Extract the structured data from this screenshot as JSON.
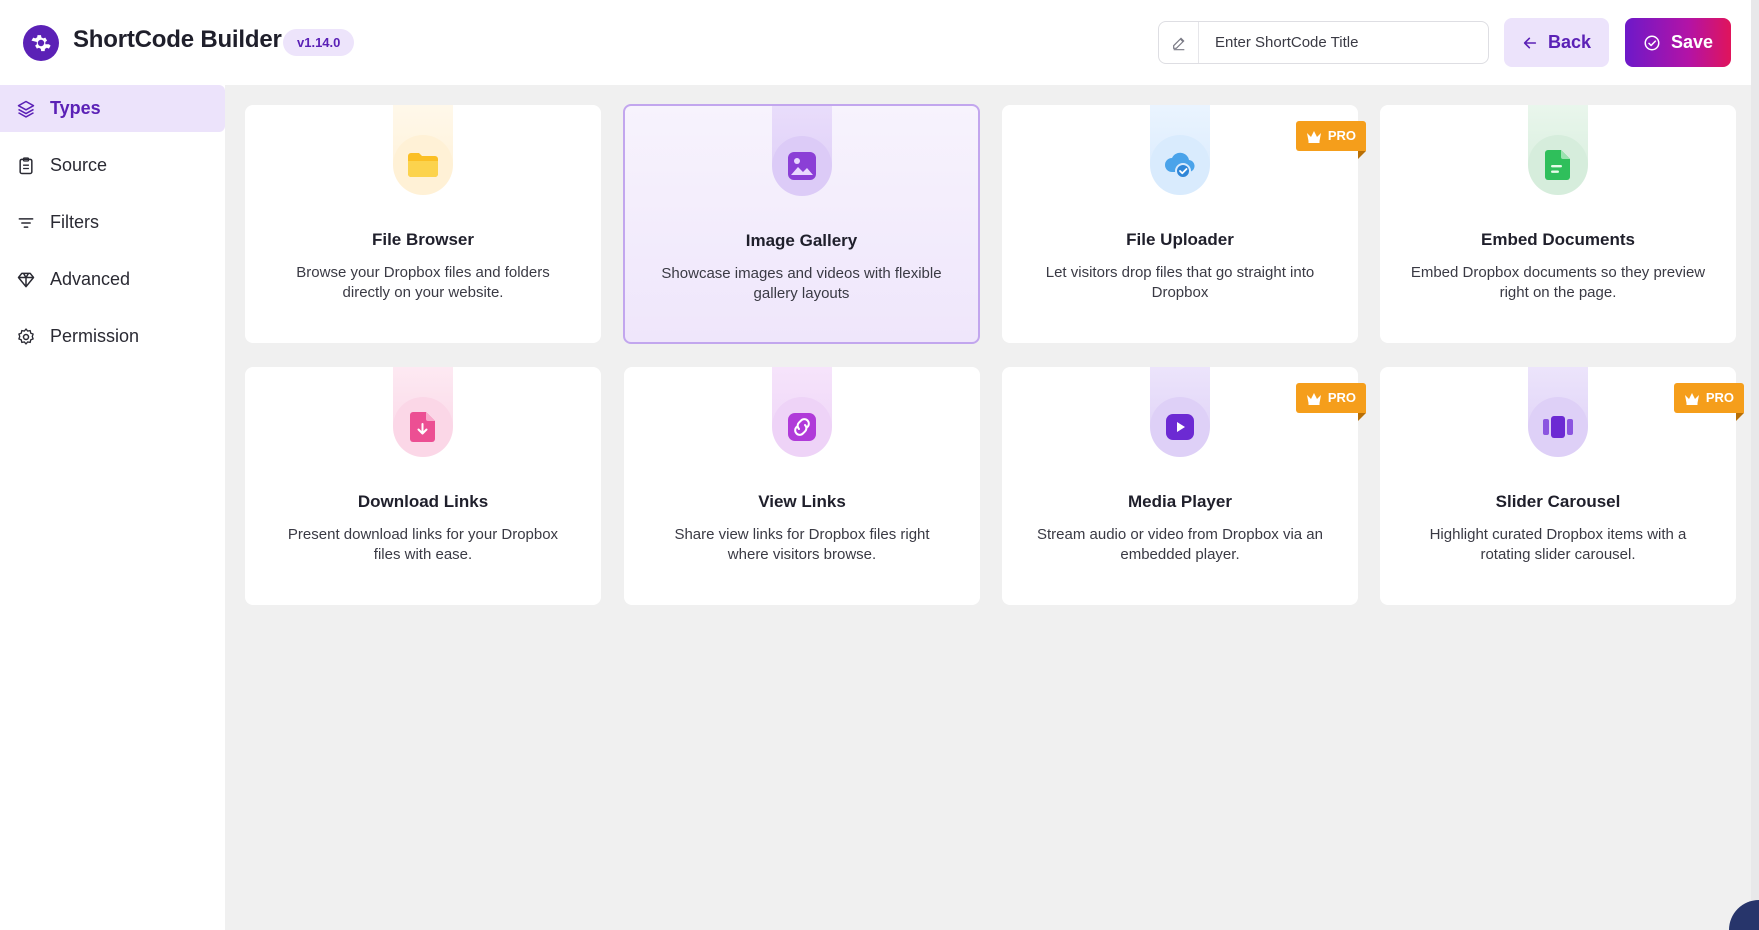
{
  "header": {
    "app_title": "ShortCode Builder",
    "version": "v1.14.0",
    "title_placeholder": "Enter ShortCode Title",
    "title_value": "",
    "back_label": "Back",
    "save_label": "Save"
  },
  "sidebar": {
    "items": [
      {
        "label": "Types",
        "icon": "layers-icon",
        "active": true
      },
      {
        "label": "Source",
        "icon": "clipboard-icon",
        "active": false
      },
      {
        "label": "Filters",
        "icon": "filter-icon",
        "active": false
      },
      {
        "label": "Advanced",
        "icon": "diamond-icon",
        "active": false
      },
      {
        "label": "Permission",
        "icon": "gear-icon",
        "active": false
      }
    ]
  },
  "types": [
    {
      "title": "File Browser",
      "desc": "Browse your Dropbox files and folders directly on your website.",
      "icon": "folder-icon",
      "pro": false,
      "selected": false
    },
    {
      "title": "Image Gallery",
      "desc": "Showcase images and videos with flexible gallery layouts",
      "icon": "image-icon",
      "pro": false,
      "selected": true
    },
    {
      "title": "File Uploader",
      "desc": "Let visitors drop files that go straight into Dropbox",
      "icon": "cloud-upload-icon",
      "pro": true,
      "selected": false
    },
    {
      "title": "Embed Documents",
      "desc": "Embed Dropbox documents so they preview right on the page.",
      "icon": "document-icon",
      "pro": false,
      "selected": false
    },
    {
      "title": "Download Links",
      "desc": "Present download links for your Dropbox files with ease.",
      "icon": "download-file-icon",
      "pro": false,
      "selected": false
    },
    {
      "title": "View Links",
      "desc": "Share view links for Dropbox files right where visitors browse.",
      "icon": "link-icon",
      "pro": false,
      "selected": false
    },
    {
      "title": "Media Player",
      "desc": "Stream audio or video from Dropbox via an embedded player.",
      "icon": "play-icon",
      "pro": true,
      "selected": false
    },
    {
      "title": "Slider Carousel",
      "desc": "Highlight curated Dropbox items with a rotating slider carousel.",
      "icon": "carousel-icon",
      "pro": true,
      "selected": false
    }
  ],
  "pro_label": "PRO",
  "colors": {
    "accent": "#5b21b6",
    "pro": "#f59e1b"
  }
}
